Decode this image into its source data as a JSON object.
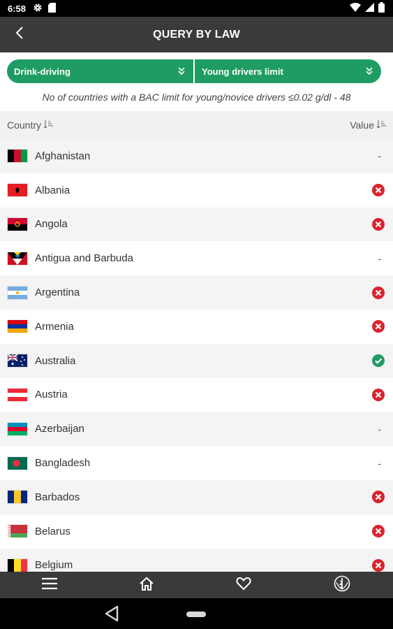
{
  "status_bar": {
    "time": "6:58"
  },
  "header": {
    "title": "QUERY BY LAW"
  },
  "filters": {
    "category": "Drink-driving",
    "subcategory": "Young drivers limit"
  },
  "summary": "No of countries with  a BAC limit for young/novice drivers ≤0.02 g/dl - 48",
  "table": {
    "columns": [
      "Country",
      "Value"
    ],
    "rows": [
      {
        "country": "Afghanistan",
        "value": "-"
      },
      {
        "country": "Albania",
        "value": "no"
      },
      {
        "country": "Angola",
        "value": "no"
      },
      {
        "country": "Antigua and Barbuda",
        "value": "-"
      },
      {
        "country": "Argentina",
        "value": "no"
      },
      {
        "country": "Armenia",
        "value": "no"
      },
      {
        "country": "Australia",
        "value": "yes"
      },
      {
        "country": "Austria",
        "value": "no"
      },
      {
        "country": "Azerbaijan",
        "value": "-"
      },
      {
        "country": "Bangladesh",
        "value": "-"
      },
      {
        "country": "Barbados",
        "value": "no"
      },
      {
        "country": "Belarus",
        "value": "no"
      },
      {
        "country": "Belgium",
        "value": "no"
      }
    ]
  },
  "colors": {
    "accent_green": "#1f9c63",
    "no_red": "#d9232e",
    "yes_green": "#1f9c63",
    "bar_dark": "#3a3a3a"
  },
  "icons": {
    "status_left": [
      "gear-icon",
      "sd-card-icon"
    ],
    "status_right": [
      "wifi-icon",
      "signal-icon",
      "battery-icon"
    ],
    "bottom_nav": [
      "menu-icon",
      "home-icon",
      "heart-icon",
      "who-logo-icon"
    ]
  }
}
